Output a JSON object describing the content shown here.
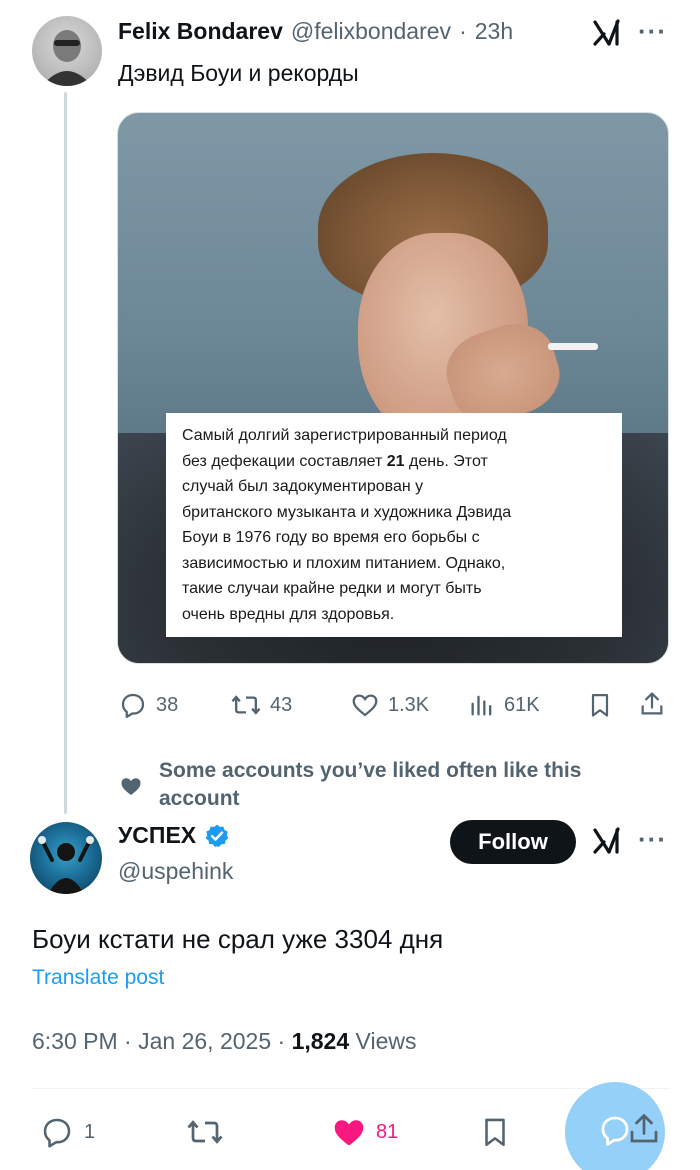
{
  "post": {
    "author_name": "Felix Bondarev",
    "author_handle": "@felixbondarev",
    "time_ago": "23h",
    "separator": "·",
    "text": "Дэвид Боуи и рекорды",
    "image_caption_lines": [
      "Самый долгий зарегистрированный период",
      "без дефекации составляет ",
      "21",
      " день. Этот",
      "случай был задокументирован у",
      "британского музыканта и художника Дэвида",
      "Боуи в 1976 году во время его борьбы с",
      "зависимостью и плохим питанием. Однако,",
      "такие случаи крайне редки и могут быть",
      "очень вредны для здоровья."
    ],
    "actions": {
      "replies": "38",
      "reposts": "43",
      "likes": "1.3K",
      "views": "61K"
    }
  },
  "social_context": "Some accounts you’ve liked often like this account",
  "reply": {
    "author_name": "УСПЕХ",
    "author_handle": "@uspehink",
    "follow_label": "Follow",
    "text": "Боуи кстати не срал уже 3304 дня",
    "translate_label": "Translate post",
    "time": "6:30 PM",
    "date": "Jan 26, 2025",
    "views_count": "1,824",
    "views_label": "Views",
    "actions": {
      "replies": "1",
      "likes": "81"
    }
  },
  "colors": {
    "accent": "#1d9bf0",
    "like": "#f91880",
    "muted": "#536471"
  }
}
